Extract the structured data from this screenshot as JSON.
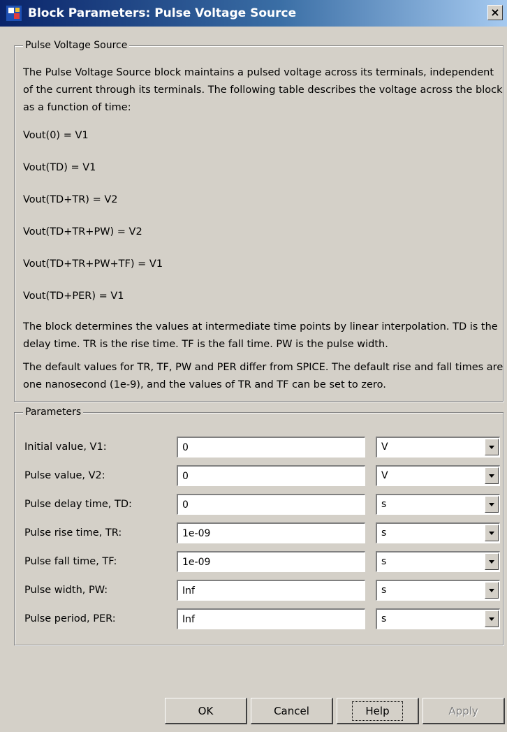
{
  "window": {
    "title": "Block Parameters: Pulse Voltage Source",
    "close_symbol": "×",
    "icon": "simulink-block-icon"
  },
  "description": {
    "group_title": "Pulse Voltage Source",
    "paragraphs": [
      "The Pulse Voltage Source block maintains a pulsed voltage across its terminals, independent of the current through its terminals. The following table describes the voltage across the block as a function of time:",
      "Vout(0) = V1",
      "Vout(TD) = V1",
      "Vout(TD+TR) = V2",
      "Vout(TD+TR+PW) = V2",
      "Vout(TD+TR+PW+TF) = V1",
      "Vout(TD+PER) = V1",
      "The block determines the values at intermediate time points by linear interpolation. TD is the delay time. TR is the rise time. TF is the fall time. PW is the pulse width.",
      "The default values for TR, TF, PW and PER differ from SPICE. The default rise and fall times are one nanosecond (1e-9), and the values of TR and TF can be set to zero."
    ]
  },
  "parameters": {
    "group_title": "Parameters",
    "rows": [
      {
        "label": "Initial value, V1:",
        "value": "0",
        "unit": "V"
      },
      {
        "label": "Pulse value, V2:",
        "value": "0",
        "unit": "V"
      },
      {
        "label": "Pulse delay time, TD:",
        "value": "0",
        "unit": "s"
      },
      {
        "label": "Pulse rise time, TR:",
        "value": "1e-09",
        "unit": "s"
      },
      {
        "label": "Pulse fall time, TF:",
        "value": "1e-09",
        "unit": "s"
      },
      {
        "label": "Pulse width, PW:",
        "value": "Inf",
        "unit": "s"
      },
      {
        "label": "Pulse period, PER:",
        "value": "Inf",
        "unit": "s"
      }
    ]
  },
  "buttons": {
    "ok": "OK",
    "cancel": "Cancel",
    "help": "Help",
    "apply": "Apply"
  },
  "colors": {
    "window_bg": "#d4d0c8",
    "title_gradient_start": "#0a246a",
    "title_gradient_end": "#a6caf0",
    "disabled_text": "#808080"
  }
}
